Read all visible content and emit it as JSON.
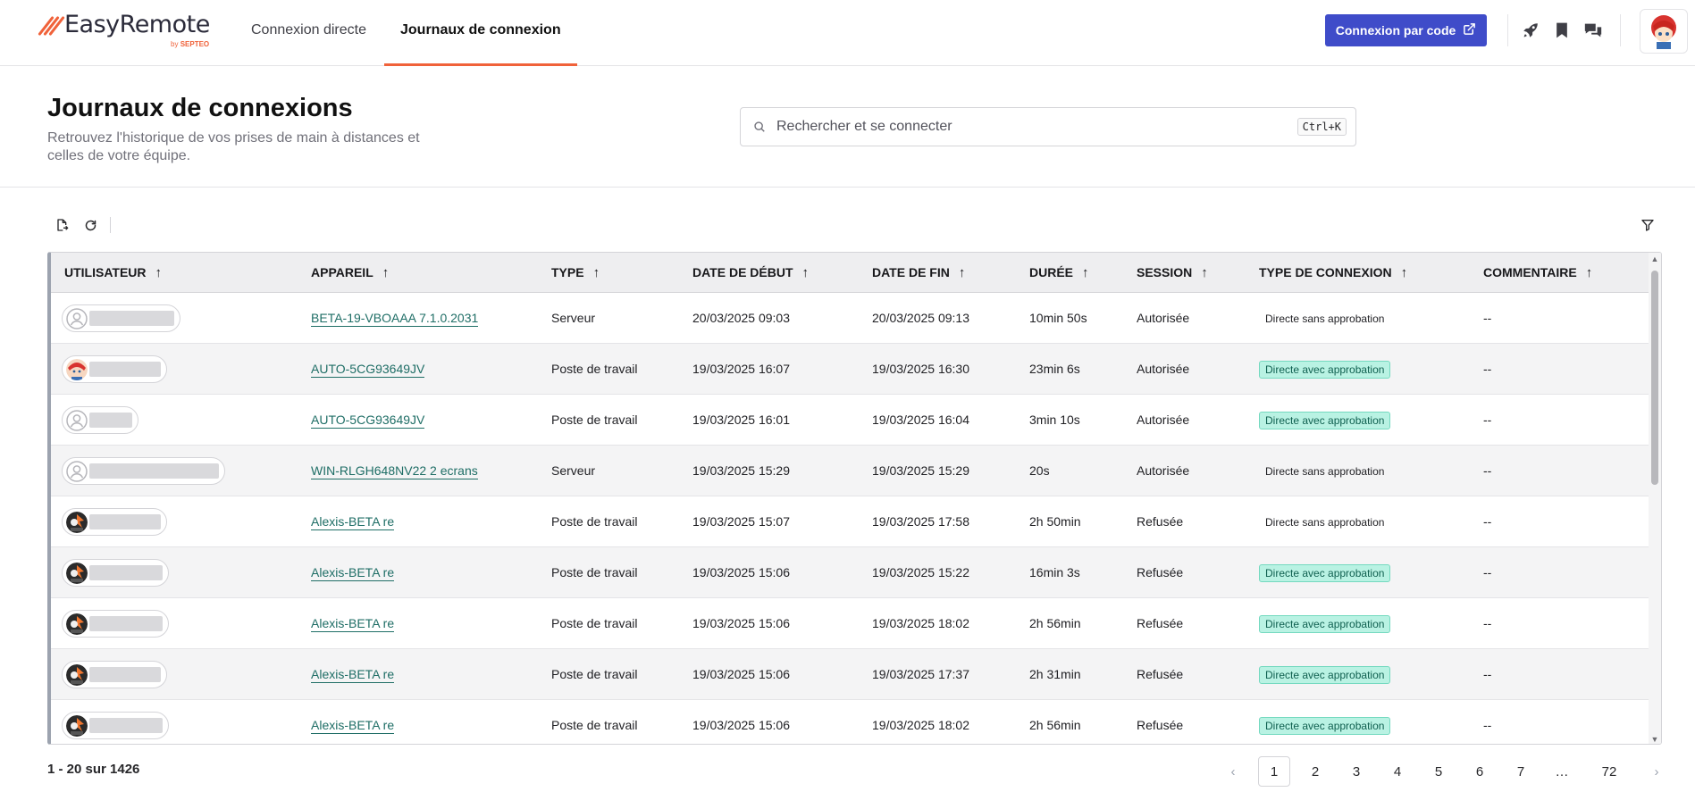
{
  "brand": {
    "name": "EasyRemote",
    "by": "by",
    "company": "SEPTEO",
    "accent": "#f0623a",
    "primary": "#3f4cc9"
  },
  "nav": {
    "tabs": [
      {
        "label": "Connexion directe",
        "active": false
      },
      {
        "label": "Journaux de connexion",
        "active": true
      }
    ],
    "code_button": "Connexion par code"
  },
  "header": {
    "title": "Journaux de connexions",
    "subtitle": "Retrouvez l'historique de vos prises de main à distances et celles de votre équipe."
  },
  "search": {
    "placeholder": "Rechercher et se connecter",
    "shortcut": "Ctrl+K"
  },
  "table": {
    "columns": [
      "UTILISATEUR",
      "APPAREIL",
      "TYPE",
      "DATE DE DÉBUT",
      "DATE DE FIN",
      "DURÉE",
      "SESSION",
      "TYPE DE CONNEXION",
      "COMMENTAIRE"
    ],
    "rows": [
      {
        "avatar": "default",
        "device": "BETA-19-VBOAAA 7.1.0.2031",
        "type": "Serveur",
        "start": "20/03/2025 09:03",
        "end": "20/03/2025 09:13",
        "duration": "10min 50s",
        "session": "Autorisée",
        "connection": "Directe sans approbation",
        "approval": false,
        "comment": "--"
      },
      {
        "avatar": "anime",
        "device": "AUTO-5CG93649JV",
        "type": "Poste de travail",
        "start": "19/03/2025 16:07",
        "end": "19/03/2025 16:30",
        "duration": "23min 6s",
        "session": "Autorisée",
        "connection": "Directe avec approbation",
        "approval": true,
        "comment": "--"
      },
      {
        "avatar": "default",
        "device": "AUTO-5CG93649JV",
        "type": "Poste de travail",
        "start": "19/03/2025 16:01",
        "end": "19/03/2025 16:04",
        "duration": "3min 10s",
        "session": "Autorisée",
        "connection": "Directe avec approbation",
        "approval": true,
        "comment": "--"
      },
      {
        "avatar": "default",
        "device": "WIN-RLGH648NV22 2 ecrans",
        "type": "Serveur",
        "start": "19/03/2025 15:29",
        "end": "19/03/2025 15:29",
        "duration": "20s",
        "session": "Autorisée",
        "connection": "Directe sans approbation",
        "approval": false,
        "comment": "--"
      },
      {
        "avatar": "dark",
        "device": "Alexis-BETA re",
        "type": "Poste de travail",
        "start": "19/03/2025 15:07",
        "end": "19/03/2025 17:58",
        "duration": "2h 50min",
        "session": "Refusée",
        "connection": "Directe sans approbation",
        "approval": false,
        "comment": "--"
      },
      {
        "avatar": "dark",
        "device": "Alexis-BETA re",
        "type": "Poste de travail",
        "start": "19/03/2025 15:06",
        "end": "19/03/2025 15:22",
        "duration": "16min 3s",
        "session": "Refusée",
        "connection": "Directe avec approbation",
        "approval": true,
        "comment": "--"
      },
      {
        "avatar": "dark",
        "device": "Alexis-BETA re",
        "type": "Poste de travail",
        "start": "19/03/2025 15:06",
        "end": "19/03/2025 18:02",
        "duration": "2h 56min",
        "session": "Refusée",
        "connection": "Directe avec approbation",
        "approval": true,
        "comment": "--"
      },
      {
        "avatar": "dark",
        "device": "Alexis-BETA re",
        "type": "Poste de travail",
        "start": "19/03/2025 15:06",
        "end": "19/03/2025 17:37",
        "duration": "2h 31min",
        "session": "Refusée",
        "connection": "Directe avec approbation",
        "approval": true,
        "comment": "--"
      },
      {
        "avatar": "dark",
        "device": "Alexis-BETA re",
        "type": "Poste de travail",
        "start": "19/03/2025 15:06",
        "end": "19/03/2025 18:02",
        "duration": "2h 56min",
        "session": "Refusée",
        "connection": "Directe avec approbation",
        "approval": true,
        "comment": "--"
      }
    ]
  },
  "footer": {
    "count": "1 - 20 sur 1426",
    "pages": [
      "1",
      "2",
      "3",
      "4",
      "5",
      "6",
      "7",
      "…",
      "72"
    ],
    "current_page": "1"
  }
}
